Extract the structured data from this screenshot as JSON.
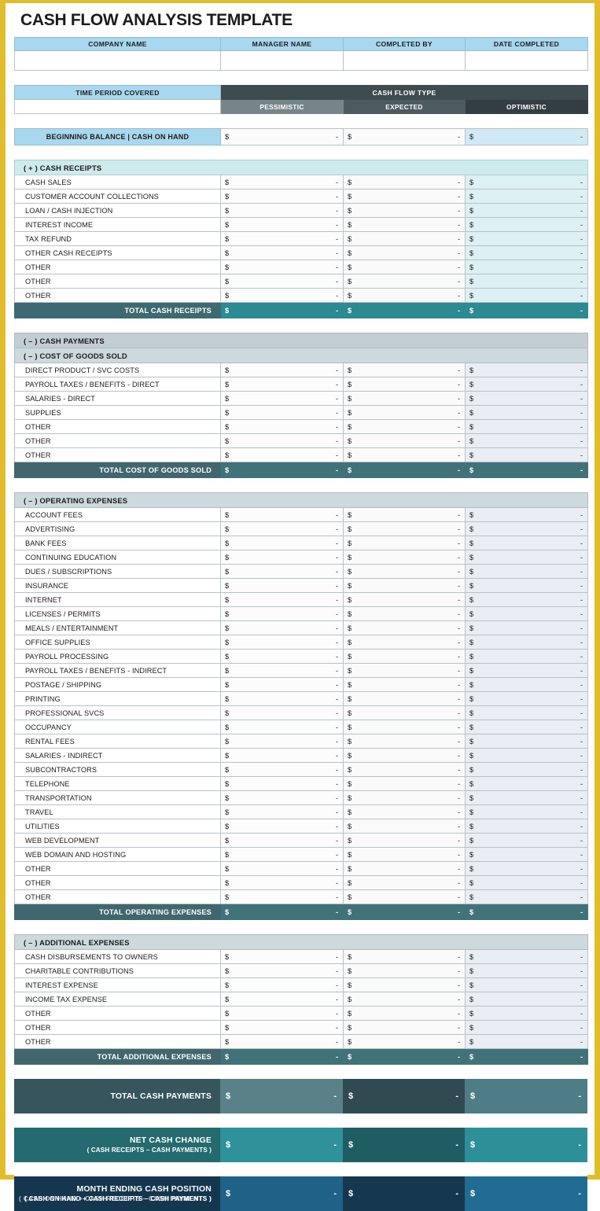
{
  "title": "CASH FLOW ANALYSIS TEMPLATE",
  "accent_border": "#e0bd2c",
  "info_headers": [
    "COMPANY NAME",
    "MANAGER NAME",
    "COMPLETED BY",
    "DATE COMPLETED"
  ],
  "info_values": [
    "",
    "",
    "",
    ""
  ],
  "time_period_label": "TIME PERIOD COVERED",
  "time_period_value": "",
  "cash_flow_type_label": "CASH FLOW TYPE",
  "scenarios": [
    "PESSIMISTIC",
    "EXPECTED",
    "OPTIMISTIC"
  ],
  "beginning_balance": {
    "label": "BEGINNING BALANCE | CASH ON HAND",
    "values": [
      "-",
      "-",
      "-"
    ]
  },
  "currency_symbol": "$",
  "dash": "-",
  "sections": [
    {
      "header": "( + )  CASH RECEIPTS",
      "rows": [
        "CASH SALES",
        "CUSTOMER ACCOUNT COLLECTIONS",
        "LOAN / CASH INJECTION",
        "INTEREST INCOME",
        "TAX REFUND",
        "OTHER CASH RECEIPTS",
        "OTHER",
        "OTHER",
        "OTHER"
      ],
      "total_label": "TOTAL CASH RECEIPTS"
    },
    {
      "header": "( – )  COST OF GOODS SOLD",
      "rows": [
        "DIRECT PRODUCT / SVC COSTS",
        "PAYROLL TAXES / BENEFITS - DIRECT",
        "SALARIES - DIRECT",
        "SUPPLIES",
        "OTHER",
        "OTHER",
        "OTHER"
      ],
      "total_label": "TOTAL COST OF GOODS SOLD"
    },
    {
      "header": "( – )  OPERATING EXPENSES",
      "rows": [
        "ACCOUNT FEES",
        "ADVERTISING",
        "BANK FEES",
        "CONTINUING EDUCATION",
        "DUES / SUBSCRIPTIONS",
        "INSURANCE",
        "INTERNET",
        "LICENSES / PERMITS",
        "MEALS / ENTERTAINMENT",
        "OFFICE SUPPLIES",
        "PAYROLL PROCESSING",
        "PAYROLL TAXES / BENEFITS - INDIRECT",
        "POSTAGE / SHIPPING",
        "PRINTING",
        "PROFESSIONAL SVCS",
        "OCCUPANCY",
        "RENTAL FEES",
        "SALARIES - INDIRECT",
        "SUBCONTRACTORS",
        "TELEPHONE",
        "TRANSPORTATION",
        "TRAVEL",
        "UTILITIES",
        "WEB DEVELOPMENT",
        "WEB DOMAIN AND HOSTING",
        "OTHER",
        "OTHER",
        "OTHER"
      ],
      "total_label": "TOTAL OPERATING EXPENSES"
    },
    {
      "header": "( – )  ADDITIONAL EXPENSES",
      "rows": [
        "CASH DISBURSEMENTS TO OWNERS",
        "CHARITABLE CONTRIBUTIONS",
        "INTEREST EXPENSE",
        "INCOME TAX EXPENSE",
        "OTHER",
        "OTHER",
        "OTHER"
      ],
      "total_label": "TOTAL ADDITIONAL EXPENSES"
    }
  ],
  "cash_payments_header": "( – )  CASH PAYMENTS",
  "summary": [
    {
      "title": "TOTAL CASH PAYMENTS",
      "subtitle": "",
      "values": [
        "-",
        "-",
        "-"
      ]
    },
    {
      "title": "NET CASH CHANGE",
      "subtitle": "( CASH RECEIPTS – CASH PAYMENTS )",
      "values": [
        "-",
        "-",
        "-"
      ]
    },
    {
      "title": "MONTH ENDING CASH POSITION",
      "subtitle": "( CASH ON HAND + CASH RECEIPTS – CASH PAYMENTS )",
      "subtitle_ghost": "( CASH ON HAND + CASH RECEIPTS – CASH PAYMENTS )",
      "values": [
        "-",
        "-",
        "-"
      ]
    }
  ]
}
